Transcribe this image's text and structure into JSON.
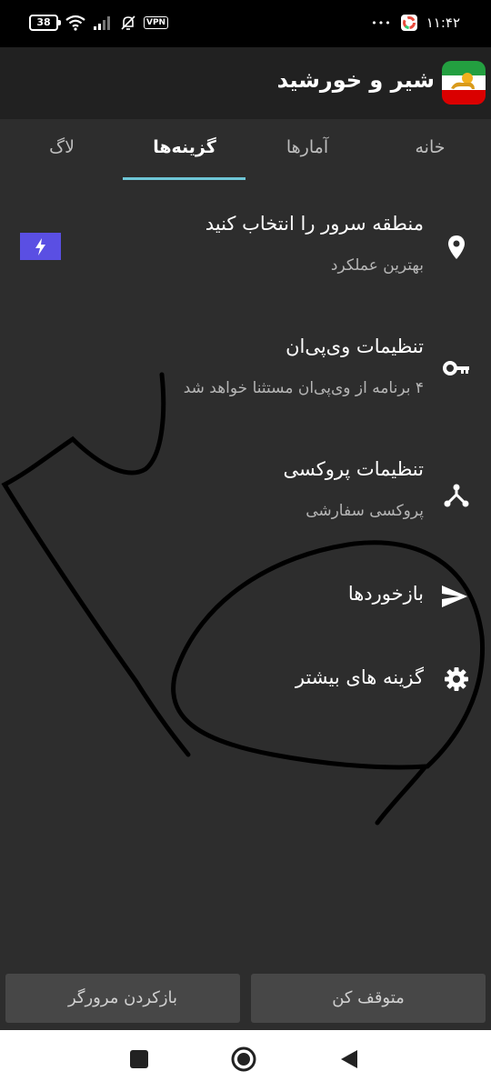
{
  "status_bar": {
    "battery": "38",
    "vpn": "VPN",
    "time": "۱۱:۴۲",
    "dots": "•••"
  },
  "app": {
    "title": "شیر و خورشید"
  },
  "tabs": [
    {
      "label": "خانه"
    },
    {
      "label": "آمارها"
    },
    {
      "label": "گزینه‌ها"
    },
    {
      "label": "لاگ"
    }
  ],
  "menu": {
    "server": {
      "title": "منطقه سرور را انتخاب کنید",
      "subtitle": "بهترین عملکرد",
      "icon": "location-pin-icon"
    },
    "vpn": {
      "title": "تنظیمات وی‌پی‌ان",
      "subtitle": "۴ برنامه از وی‌پی‌ان مستثنا خواهد شد",
      "icon": "key-icon"
    },
    "proxy": {
      "title": "تنظیمات پروکسی",
      "subtitle": "پروکسی سفارشی",
      "icon": "proxy-fork-icon"
    },
    "feedback": {
      "title": "بازخوردها",
      "icon": "send-icon"
    },
    "more": {
      "title": "گزینه های بیشتر",
      "icon": "gear-icon"
    }
  },
  "buttons": {
    "stop": "متوقف کن",
    "open_browser": "بازکردن مرورگر"
  },
  "colors": {
    "background": "#2d2d2d",
    "appbar": "#212121",
    "tab_indicator": "#6ec6d6",
    "flash_badge": "#5a4fe3"
  }
}
